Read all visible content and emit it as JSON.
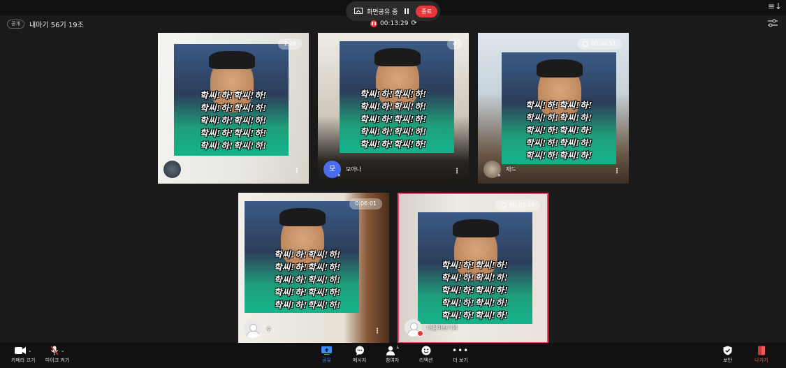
{
  "screen_share": {
    "label": "화면공유 중",
    "stop_label": "종료"
  },
  "meeting": {
    "public_badge": "공개",
    "title": "내마기 56기 19조",
    "recording_time": "00:13:29"
  },
  "overlay_lines": [
    "학씨!하!학씨!하!",
    "학씨!하!학씨!하!",
    "학씨!하!학씨!하!",
    "학씨!하!학씨!하!",
    "학씨!하!학씨!하!"
  ],
  "tiles": [
    {
      "name": "",
      "timer": "1:29"
    },
    {
      "name": "모아나",
      "timer": "4",
      "initial": "모"
    },
    {
      "name": "제드",
      "timer": "00:08:51"
    },
    {
      "name": "수",
      "timer": "0:06:01"
    },
    {
      "name": "내집마련기원",
      "timer": "00:07:49"
    }
  ],
  "toolbar": {
    "camera": "카메라 끄기",
    "mic": "마이크 켜기",
    "share": "공유",
    "message": "메시지",
    "participants": "참여자",
    "participants_count": "5",
    "reaction": "리액션",
    "more": "더 보기",
    "security": "보안",
    "leave": "나가기"
  },
  "colors": {
    "accent": "#3d8bff",
    "danger": "#e8363b",
    "active_border": "#ff3d6b"
  }
}
